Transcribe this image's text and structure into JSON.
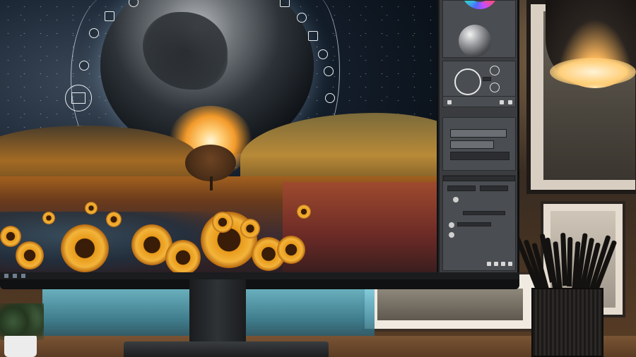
{
  "scene": {
    "subject": "",
    "screen_image": ""
  },
  "colors": {
    "panel_bg": "#3a3c3f",
    "panel_section": "#4a4d51",
    "backlight": "#6fc4d8",
    "sun": "#ffd07a"
  },
  "icons": {
    "hud": [
      "circle-node-icon",
      "square-node-icon",
      "device-icon",
      "lock-icon",
      "user-icon",
      "diamond-icon"
    ],
    "panel": [
      "color-wheel-icon",
      "sphere-preview-icon",
      "brush-ring-icon"
    ]
  }
}
